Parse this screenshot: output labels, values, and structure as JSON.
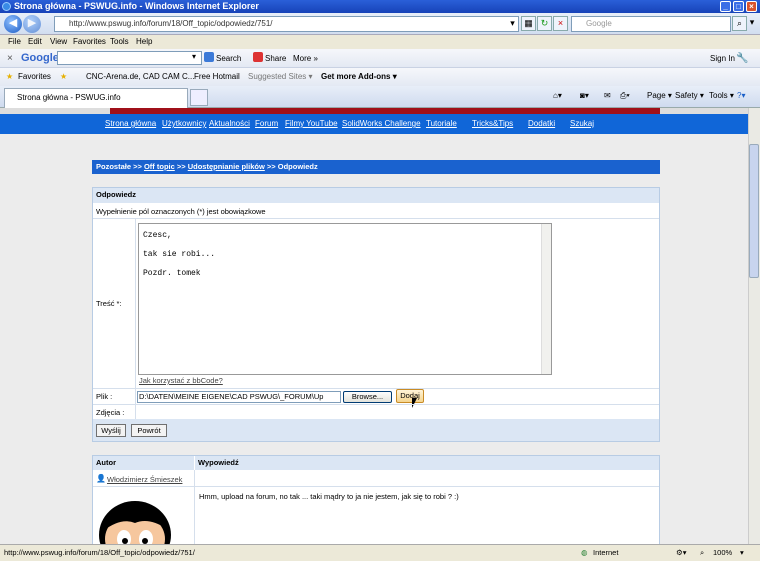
{
  "window": {
    "title": "Strona główna - PSWUG.info - Windows Internet Explorer"
  },
  "address": {
    "url": "http://www.pswug.info/forum/18/Off_topic/odpowiedz/751/",
    "search_placeholder": "Google"
  },
  "menu": [
    "File",
    "Edit",
    "View",
    "Favorites",
    "Tools",
    "Help"
  ],
  "google_toolbar": {
    "logo": "Google",
    "search_label": "Search",
    "share_label": "Share",
    "more_label": "More »",
    "signin_label": "Sign In"
  },
  "favorites_bar": {
    "favorites_label": "Favorites",
    "items": [
      "CNC-Arena.de, CAD CAM C...",
      "Free Hotmail",
      "Suggested Sites ▾",
      "Get more Add-ons ▾"
    ]
  },
  "tab": {
    "label": "Strona główna - PSWUG.info"
  },
  "command_bar": [
    "Page ▾",
    "Safety ▾",
    "Tools ▾"
  ],
  "site_nav": [
    "Strona główna",
    "Użytkownicy",
    "Aktualności",
    "Forum",
    "Filmy YouTube",
    "SolidWorks Challenge",
    "Tutoriale",
    "Tricks&Tips",
    "Dodatki",
    "Szukaj"
  ],
  "breadcrumb": {
    "root": "Pozostałe",
    "sep1": " >> ",
    "item1": "Off topic",
    "sep2": " >> ",
    "item2": "Udostępnianie plików",
    "sep3": " >> ",
    "current": "Odpowiedz"
  },
  "form": {
    "header": "Odpowiedz",
    "notice": "Wypełnienie pól oznaczonych (*) jest obowiązkowe",
    "content_label": "Treść *:",
    "content_lines": [
      "Czesc,",
      "",
      "tak sie robi...",
      "",
      "Pozdr. tomek"
    ],
    "bbcode_link": "Jak korzystać z bbCode?",
    "file_label": "Plik :",
    "file_value": "D:\\DATEN\\MEINE EIGENE\\CAD PSWUG\\_FORUM\\Up",
    "browse_label": "Browse...",
    "add_label": "Dodaj",
    "images_label": "Zdjęcia :",
    "submit_label": "Wyślij",
    "back_label": "Powrót"
  },
  "posts": {
    "col_author": "Autor",
    "col_reply": "Wypowiedź",
    "author": "Włodzimierz Śmieszek",
    "reply": "Hmm, upload na forum, no tak ... taki mądry to ja nie jestem, jak się to robi ? :)"
  },
  "status": {
    "url": "http://www.pswug.info/forum/18/Off_topic/odpowiedz/751/",
    "zone": "Internet",
    "zoom": "100%"
  }
}
